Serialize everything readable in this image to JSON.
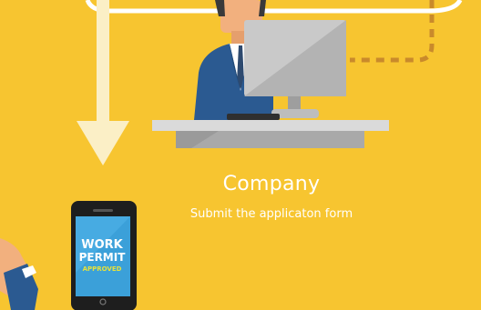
{
  "company": {
    "title": "Company",
    "subtitle": "Submit the applicaton form"
  },
  "phone": {
    "line1": "WORK",
    "line2": "PERMIT",
    "line3": "APPROVED"
  },
  "colors": {
    "background": "#F7C530",
    "arrow": "#FBEFC6",
    "dashed_connector": "#C98A2B",
    "suit": "#2B5A91",
    "monitor": "#C9C9C9",
    "desk": "#D6D6D6",
    "phone_screen": "#3BA0D9"
  }
}
